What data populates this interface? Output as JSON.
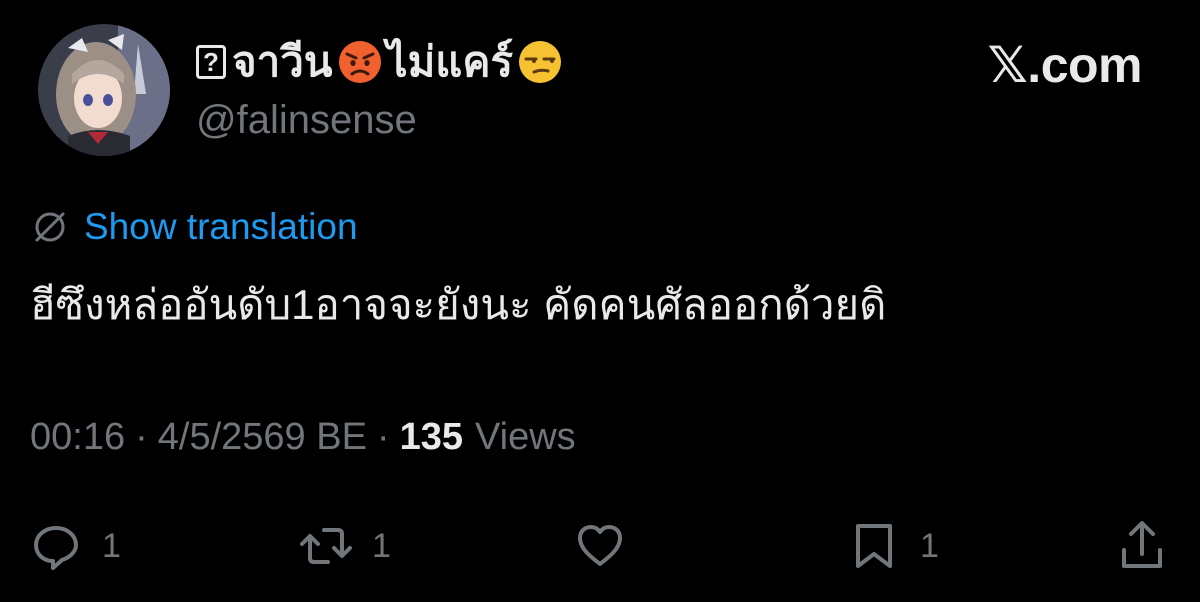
{
  "header": {
    "display_name_prefix_glyph": "?",
    "display_name_part1": "จาวีน",
    "display_name_emoji1": "angry-face-emoji",
    "display_name_part2": "ไม่แคร์",
    "display_name_emoji2": "unamused-face-emoji",
    "handle": "@falinsense",
    "brand": "𝕏.com"
  },
  "post": {
    "translate_link": "Show translation",
    "text": "ฮีซึงหล่ออันดับ1อาจจะยังนะ คัดคนศัลออกด้วยดิ",
    "time": "00:16",
    "date": "4/5/2569 BE",
    "separator": "·",
    "views_count": "135",
    "views_label": "Views"
  },
  "actions": {
    "reply_count": "1",
    "repost_count": "1",
    "like_count": "",
    "bookmark_count": "1"
  },
  "colors": {
    "background": "#000000",
    "text": "#e7e9ea",
    "muted": "#71767b",
    "link": "#1d9bf0"
  }
}
